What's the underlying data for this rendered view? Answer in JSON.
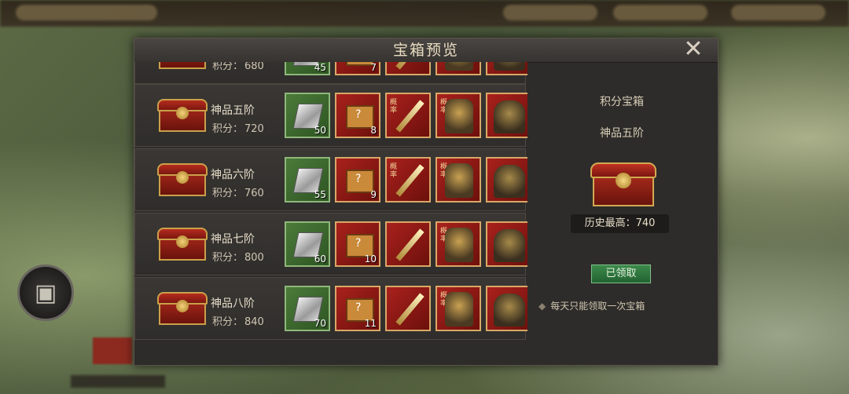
{
  "dialog": {
    "title": "宝箱预览",
    "close_icon": "close-icon"
  },
  "rows": [
    {
      "tier": "",
      "score_label": "积分：",
      "score": "680",
      "silver_qty": "45",
      "box_qty": "7"
    },
    {
      "tier": "神品五阶",
      "score_label": "积分：",
      "score": "720",
      "silver_qty": "50",
      "box_qty": "8"
    },
    {
      "tier": "神品六阶",
      "score_label": "积分：",
      "score": "760",
      "silver_qty": "55",
      "box_qty": "9"
    },
    {
      "tier": "神品七阶",
      "score_label": "积分：",
      "score": "800",
      "silver_qty": "60",
      "box_qty": "10"
    },
    {
      "tier": "神品八阶",
      "score_label": "积分：",
      "score": "840",
      "silver_qty": "70",
      "box_qty": "11"
    }
  ],
  "item_tag": "概率",
  "detail": {
    "title": "积分宝箱",
    "tier": "神品五阶",
    "record_label": "历史最高：",
    "record_value": "740",
    "claim_button": "已领取",
    "note": "每天只能领取一次宝箱"
  }
}
